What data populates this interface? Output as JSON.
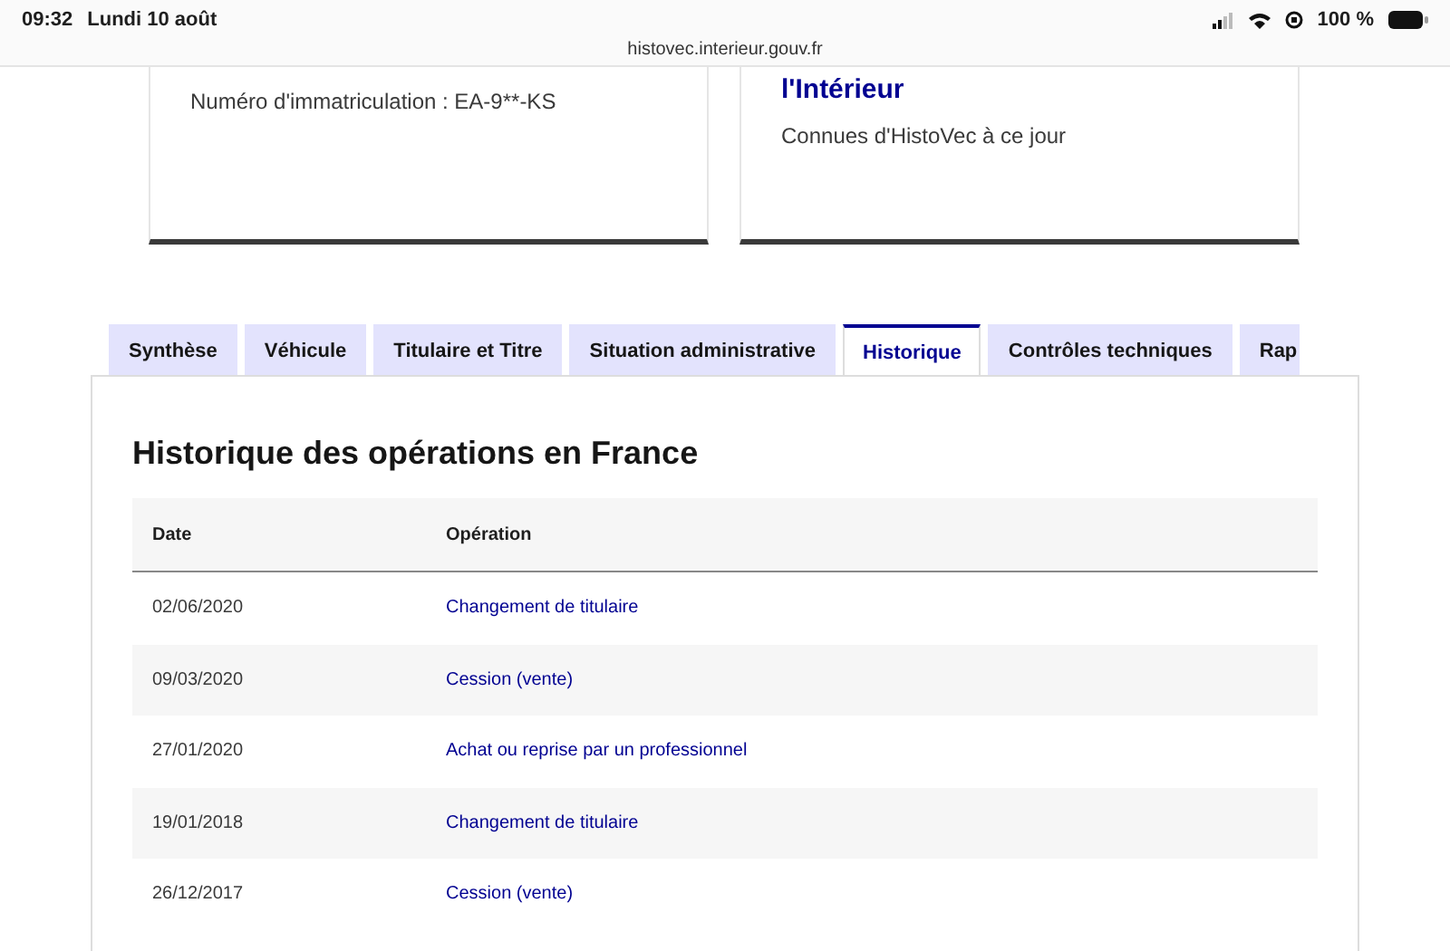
{
  "status_bar": {
    "time": "09:32",
    "date": "Lundi 10 août",
    "battery": "100 %"
  },
  "address_bar": {
    "url": "histovec.interieur.gouv.fr"
  },
  "cards": [
    {
      "text": "Numéro d'immatriculation : EA-9**-KS"
    },
    {
      "title": "l'Intérieur",
      "text": "Connues d'HistoVec à ce jour"
    }
  ],
  "tabs": [
    {
      "label": "Synthèse",
      "selected": false
    },
    {
      "label": "Véhicule",
      "selected": false
    },
    {
      "label": "Titulaire et Titre",
      "selected": false
    },
    {
      "label": "Situation administrative",
      "selected": false
    },
    {
      "label": "Historique",
      "selected": true
    },
    {
      "label": "Contrôles techniques",
      "selected": false
    },
    {
      "label": "Rap",
      "selected": false
    }
  ],
  "section": {
    "title": "Historique des opérations en France",
    "table": {
      "columns": [
        "Date",
        "Opération"
      ],
      "rows": [
        {
          "date": "02/06/2020",
          "operation": "Changement de titulaire"
        },
        {
          "date": "09/03/2020",
          "operation": "Cession (vente)"
        },
        {
          "date": "27/01/2020",
          "operation": "Achat ou reprise par un professionnel"
        },
        {
          "date": "19/01/2018",
          "operation": "Changement de titulaire"
        },
        {
          "date": "26/12/2017",
          "operation": "Cession (vente)"
        }
      ]
    }
  }
}
